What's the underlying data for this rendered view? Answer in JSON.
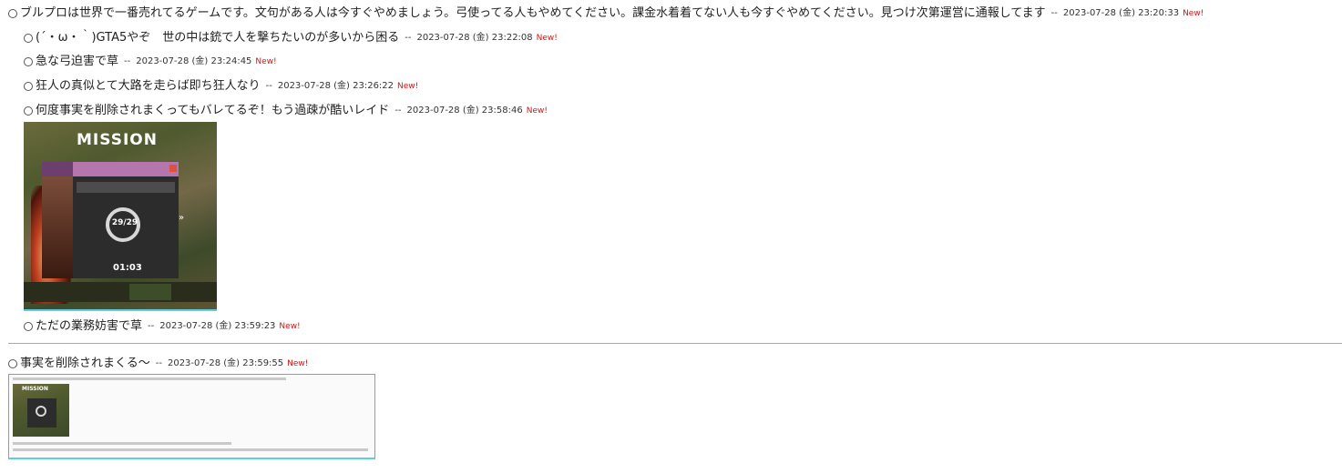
{
  "thread": {
    "root": {
      "text": "ブルプロは世界で一番売れてるゲームです。文句がある人は今すぐやめましょう。弓使ってる人もやめてください。課金水着着てない人も今すぐやめてください。見つけ次第運営に通報してます",
      "separator": "--",
      "timestamp": "2023-07-28 (金) 23:20:33",
      "new_label": "New!"
    },
    "replies": [
      {
        "text": "(´・ω・｀)GTA5やぞ　世の中は銃で人を撃ちたいのが多いから困る",
        "separator": "--",
        "timestamp": "2023-07-28 (金) 23:22:08",
        "new_label": "New!"
      },
      {
        "text": "急な弓迫害で草",
        "separator": "--",
        "timestamp": "2023-07-28 (金) 23:24:45",
        "new_label": "New!"
      },
      {
        "text": "狂人の真似とて大路を走らば即ち狂人なり",
        "separator": "--",
        "timestamp": "2023-07-28 (金) 23:26:22",
        "new_label": "New!"
      },
      {
        "text": "何度事実を削除されまくってもバレてるぞ！もう過疎が酷いレイド",
        "separator": "--",
        "timestamp": "2023-07-28 (金) 23:58:46",
        "new_label": "New!"
      },
      {
        "text": "ただの業務妨害で草",
        "separator": "--",
        "timestamp": "2023-07-28 (金) 23:59:23",
        "new_label": "New!"
      }
    ],
    "attached_image": {
      "title": "MISSION",
      "counter": "29/29",
      "timer": "01:03"
    }
  },
  "second_thread": {
    "root": {
      "text": "事実を削除されまくる～",
      "separator": "--",
      "timestamp": "2023-07-28 (金) 23:59:55",
      "new_label": "New!"
    },
    "thumbnail": {
      "title": "MISSION"
    }
  },
  "colors": {
    "new_label": "#e01010",
    "divider": "#a8a8a8",
    "image_underline": "#5ad0e0"
  }
}
